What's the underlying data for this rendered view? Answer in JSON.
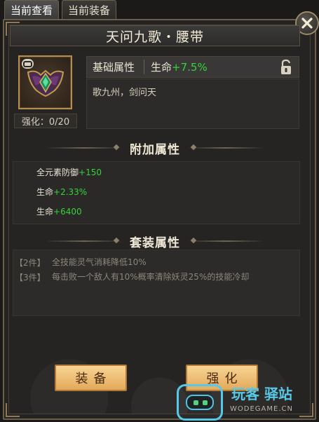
{
  "tabs": [
    {
      "label": "当前查看",
      "active": true
    },
    {
      "label": "当前装备",
      "active": false
    }
  ],
  "title": "天问九歌・腰带",
  "item": {
    "icon": "belt-icon",
    "enhance": "强化：0/20"
  },
  "base_attributes": {
    "label": "基础属性",
    "stat_name": "生命",
    "stat_value": "+7.5%"
  },
  "description": "歌九州，剑问天",
  "extra_attributes": {
    "title": "附加属性",
    "lines": [
      {
        "name": "全元素防御",
        "value": "+150"
      },
      {
        "name": "生命",
        "value": "+2.33%"
      },
      {
        "name": "生命",
        "value": "+6400"
      }
    ]
  },
  "set_attributes": {
    "title": "套装属性",
    "lines": [
      {
        "tag": "【2件】",
        "text": "全技能灵气消耗降低10%"
      },
      {
        "tag": "【3件】",
        "text": "每击败一个敌人有10%概率清除妖灵25%的技能冷却"
      }
    ]
  },
  "buttons": {
    "equip": "装备",
    "enhance": "强化"
  },
  "watermark": {
    "brand": "玩客 驿站",
    "domain": "WODEGAME.CN"
  },
  "colors": {
    "accent_green": "#34d43a",
    "button_gold": "#efbe74"
  }
}
